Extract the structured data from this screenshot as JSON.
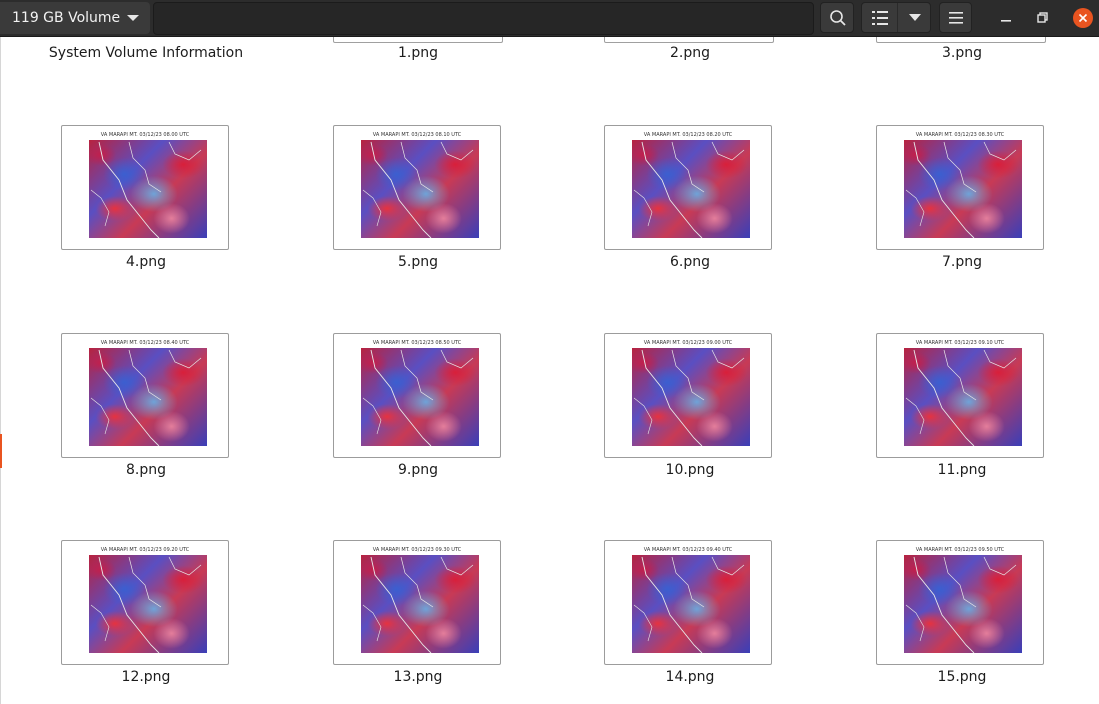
{
  "header": {
    "location": "119 GB Volume"
  },
  "top_row_partial": [
    "System Volume Information",
    "1.png",
    "2.png",
    "3.png"
  ],
  "thumbnail_caption_prefix": "VA MARAPI MT. 03/12/23",
  "files": [
    {
      "name": "4.png",
      "caption": "VA MARAPI MT. 03/12/23 08.00 UTC"
    },
    {
      "name": "5.png",
      "caption": "VA MARAPI MT. 03/12/23 08.10 UTC"
    },
    {
      "name": "6.png",
      "caption": "VA MARAPI MT. 03/12/23 08.20 UTC"
    },
    {
      "name": "7.png",
      "caption": "VA MARAPI MT. 03/12/23 08.30 UTC"
    },
    {
      "name": "8.png",
      "caption": "VA MARAPI MT. 03/12/23 08.40 UTC"
    },
    {
      "name": "9.png",
      "caption": "VA MARAPI MT. 03/12/23 08.50 UTC"
    },
    {
      "name": "10.png",
      "caption": "VA MARAPI MT. 03/12/23 09.00 UTC"
    },
    {
      "name": "11.png",
      "caption": "VA MARAPI MT. 03/12/23 09.10 UTC"
    },
    {
      "name": "12.png",
      "caption": "VA MARAPI MT. 03/12/23 09.20 UTC"
    },
    {
      "name": "13.png",
      "caption": "VA MARAPI MT. 03/12/23 09.30 UTC"
    },
    {
      "name": "14.png",
      "caption": "VA MARAPI MT. 03/12/23 09.40 UTC"
    },
    {
      "name": "15.png",
      "caption": "VA MARAPI MT. 03/12/23 09.50 UTC"
    }
  ],
  "icons": {
    "search": "search-icon",
    "view_list": "list-view-icon",
    "view_options": "chevron-down-icon",
    "menu": "hamburger-menu-icon",
    "minimize": "minimize-icon",
    "maximize": "restore-icon",
    "close": "close-icon"
  },
  "colors": {
    "header_bg": "#2c2c2c",
    "close_button": "#e95420",
    "accent": "#e95420"
  }
}
